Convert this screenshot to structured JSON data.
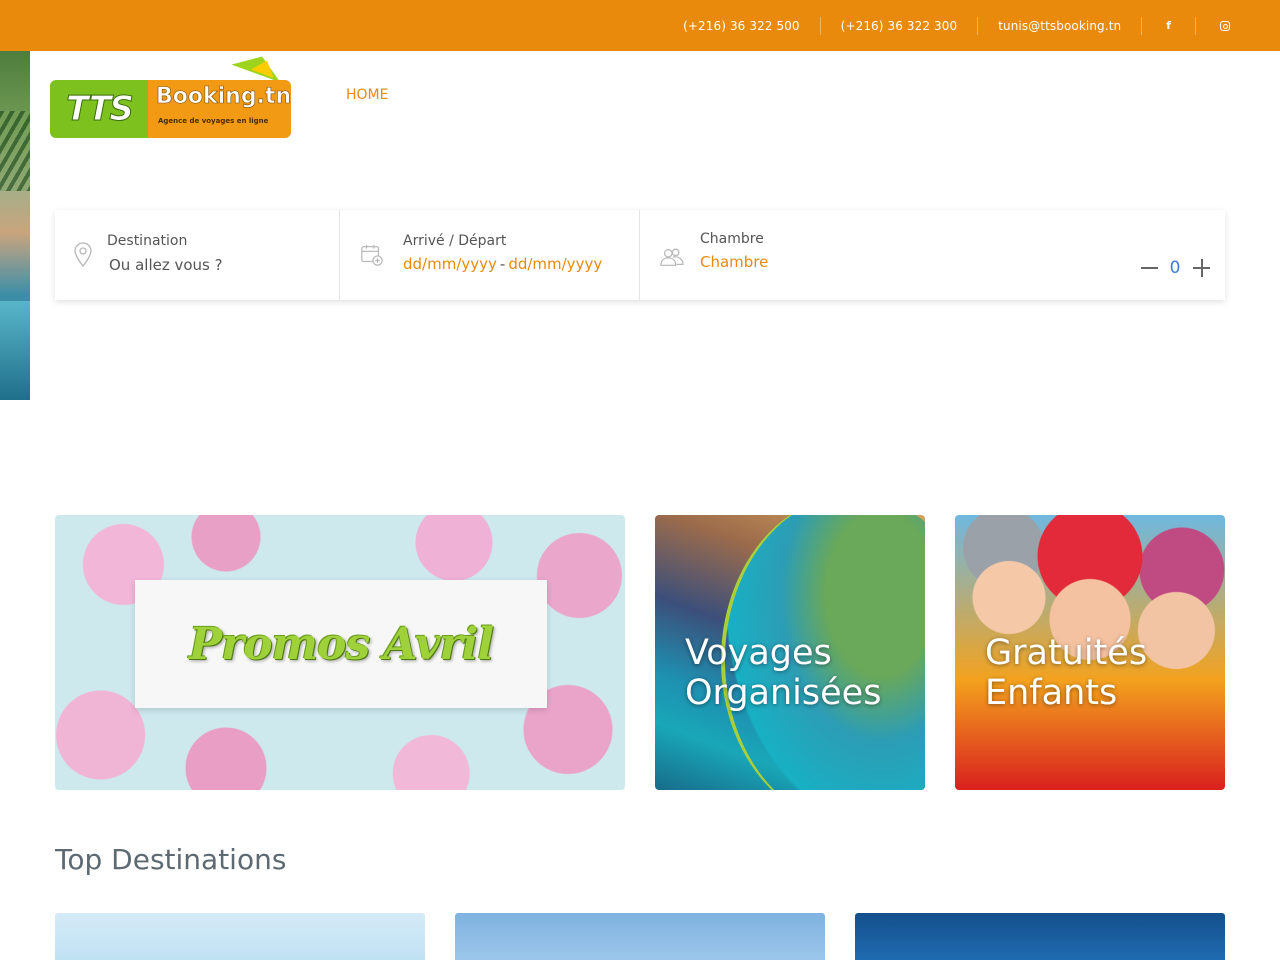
{
  "topbar": {
    "phone1": "(+216) 36 322 500",
    "phone2": "(+216) 36 322 300",
    "email": "tunis@ttsbooking.tn",
    "facebook_glyph": "f",
    "icons": [
      "facebook-icon",
      "instagram-icon"
    ],
    "color": "#e98a0c"
  },
  "logo": {
    "mark": "TTS",
    "name": "Booking.tn",
    "tagline": "Agence de voyages en ligne"
  },
  "nav": {
    "home": "HOME"
  },
  "search": {
    "destination_label": "Destination",
    "destination_placeholder": "Ou allez vous ?",
    "dates_label": "Arrivé / Départ",
    "date_from": "dd/mm/yyyy",
    "date_sep": "-",
    "date_to": "dd/mm/yyyy",
    "room_label": "Chambre",
    "room_value": "Chambre",
    "room_count": "0",
    "icons": [
      "map-pin-icon",
      "calendar-add-icon",
      "users-icon",
      "minus-icon",
      "plus-icon"
    ]
  },
  "promos": {
    "promo1_title": "Promos Avril",
    "promo2_line1": "Voyages",
    "promo2_line2": "Organisées",
    "promo3_line1": "Gratuités",
    "promo3_line2": "Enfants"
  },
  "destinations": {
    "title": "Top Destinations"
  },
  "colors": {
    "accent": "#e98a0c",
    "counter": "#3d7fd6"
  }
}
